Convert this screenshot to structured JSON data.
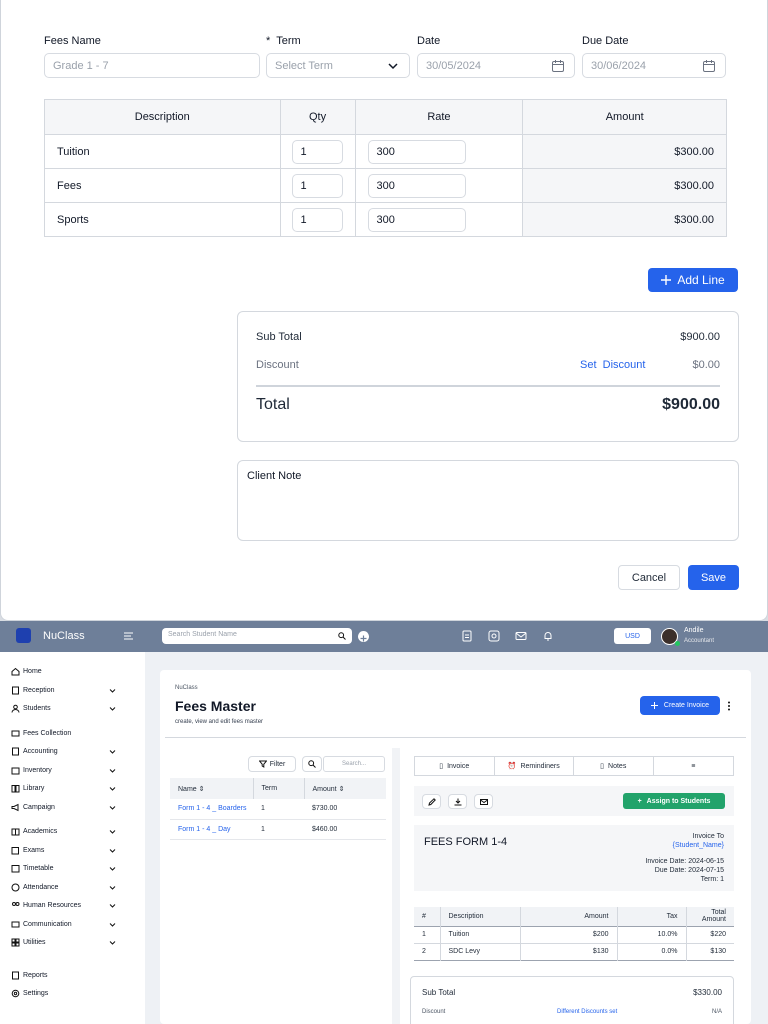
{
  "form": {
    "fees_name_label": "Fees Name",
    "fees_name_placeholder": "Grade 1 - 7",
    "term_required": "*",
    "term_label": "Term",
    "term_placeholder": "Select Term",
    "date_label": "Date",
    "date_value": "30/05/2024",
    "due_date_label": "Due Date",
    "due_date_value": "30/06/2024"
  },
  "lines": {
    "headers": [
      "Description",
      "Qty",
      "Rate",
      "Amount"
    ],
    "rows": [
      {
        "desc": "Tuition",
        "qty": "1",
        "rate": "300",
        "amount": "$300.00"
      },
      {
        "desc": "Fees",
        "qty": "1",
        "rate": "300",
        "amount": "$300.00"
      },
      {
        "desc": "Sports",
        "qty": "1",
        "rate": "300",
        "amount": "$300.00"
      }
    ],
    "add_line": "Add Line"
  },
  "summary": {
    "subtotal_label": "Sub Total",
    "subtotal_value": "$900.00",
    "discount_label": "Discount",
    "set_discount": "Set  Discount",
    "discount_value": "$0.00",
    "total_label": "Total",
    "total_value": "$900.00"
  },
  "note": {
    "label": "Client Note"
  },
  "actions": {
    "cancel": "Cancel",
    "save": "Save"
  },
  "app": {
    "brand": "NuClass",
    "search_placeholder": "Search Student Name",
    "currency": "USD",
    "user_name": "Andile",
    "user_role": "Accountant"
  },
  "sidebar": {
    "items": [
      "Home",
      "Reception",
      "Students",
      "Fees Collection",
      "Accounting",
      "Inventory",
      "Library",
      "Campaign",
      "Academics",
      "Exams",
      "Timetable",
      "Attendance",
      "Human Resources",
      "Communication",
      "Utilities",
      "Reports",
      "Settings"
    ]
  },
  "page": {
    "breadcrumb": "NuClass",
    "title": "Fees Master",
    "subtitle": "create, view and edit fees master",
    "create_invoice": "Create Invoice"
  },
  "list": {
    "filter": "Filter",
    "search_placeholder": "Search...",
    "headers": [
      "Name",
      "Term",
      "Amount"
    ],
    "rows": [
      {
        "name": "Form 1 - 4 _ Boarders",
        "term": "1",
        "amount": "$730.00"
      },
      {
        "name": "Form 1 - 4 _ Day",
        "term": "1",
        "amount": "$460.00"
      }
    ]
  },
  "detail": {
    "tabs": [
      "Invoice",
      "Remindiners",
      "Notes"
    ],
    "assign": "Assign to Students",
    "fees_title": "FEES FORM 1-4",
    "invoice_to": "Invoice To",
    "student_name": "{Student_Name}",
    "invoice_date": "Invoice Date: 2024-06-15",
    "due_date": "Due Date: 2024-07-15",
    "term": "Term: 1",
    "headers": [
      "#",
      "Description",
      "Amount",
      "Tax",
      "Total Amount"
    ],
    "rows": [
      {
        "n": "1",
        "desc": "Tuition",
        "amount": "$200",
        "tax": "10.0%",
        "total": "$220"
      },
      {
        "n": "2",
        "desc": "SDC Levy",
        "amount": "$130",
        "tax": "0.0%",
        "total": "$130"
      }
    ],
    "subtotal_label": "Sub Total",
    "subtotal_value": "$330.00",
    "discount_label": "Discount",
    "discount_link": "Different Discounts set",
    "discount_value": "N/A"
  }
}
